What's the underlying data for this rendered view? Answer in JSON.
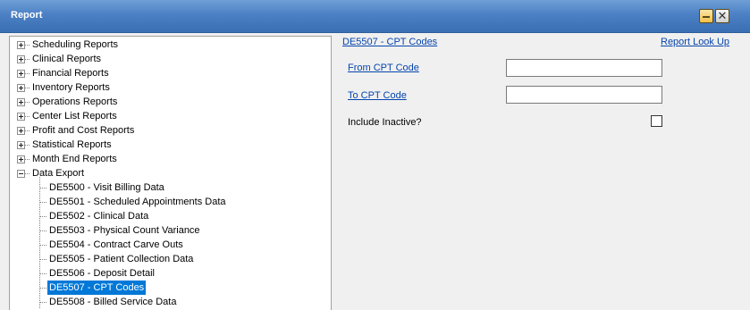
{
  "window": {
    "title": "Report",
    "minimize_icon": "minimize-icon",
    "close_icon": "close-icon",
    "close_glyph": "✕"
  },
  "tree": {
    "categories": [
      {
        "label": "Scheduling Reports",
        "expanded": false
      },
      {
        "label": "Clinical Reports",
        "expanded": false
      },
      {
        "label": "Financial Reports",
        "expanded": false
      },
      {
        "label": "Inventory Reports",
        "expanded": false
      },
      {
        "label": "Operations Reports",
        "expanded": false
      },
      {
        "label": "Center List Reports",
        "expanded": false
      },
      {
        "label": "Profit and Cost Reports",
        "expanded": false
      },
      {
        "label": "Statistical Reports",
        "expanded": false
      },
      {
        "label": "Month End Reports",
        "expanded": false
      },
      {
        "label": "Data Export",
        "expanded": true
      }
    ],
    "children": [
      {
        "label": "DE5500 - Visit Billing Data",
        "selected": false
      },
      {
        "label": "DE5501 - Scheduled Appointments Data",
        "selected": false
      },
      {
        "label": "DE5502 - Clinical Data",
        "selected": false
      },
      {
        "label": "DE5503 - Physical Count Variance",
        "selected": false
      },
      {
        "label": "DE5504 - Contract Carve Outs",
        "selected": false
      },
      {
        "label": "DE5505 - Patient Collection Data",
        "selected": false
      },
      {
        "label": "DE5506 - Deposit Detail",
        "selected": false
      },
      {
        "label": "DE5507 - CPT Codes",
        "selected": true
      },
      {
        "label": "DE5508 - Billed Service Data",
        "selected": false
      }
    ]
  },
  "form": {
    "report_title": "DE5507 - CPT Codes",
    "lookup_link": "Report Look Up",
    "from_label": "From CPT Code",
    "from_value": "",
    "to_label": "To CPT Code",
    "to_value": "",
    "include_inactive_label": "Include Inactive?",
    "include_inactive_checked": false
  }
}
